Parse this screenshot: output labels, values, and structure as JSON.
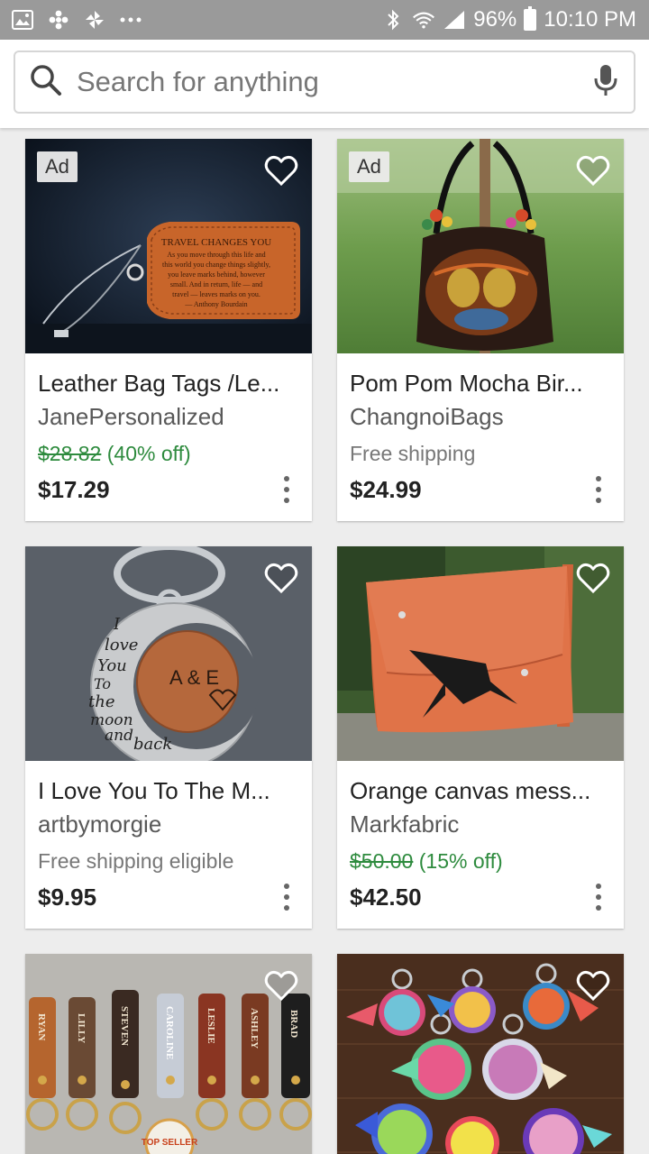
{
  "status_bar": {
    "battery": "96%",
    "time": "10:10 PM",
    "icons_left": [
      "image-icon",
      "fan-icon",
      "pinwheel-icon",
      "more-dots-icon"
    ],
    "icons_right": [
      "bluetooth-icon",
      "wifi-icon",
      "signal-icon",
      "battery-icon"
    ]
  },
  "search": {
    "placeholder": "Search for anything",
    "value": ""
  },
  "listings": [
    {
      "ad": "Ad",
      "title": "Leather Bag Tags /Le...",
      "shop": "JanePersonalized",
      "original_price": "$28.82",
      "discount": "(40% off)",
      "shipping": "",
      "price": "$17.29",
      "image": "leather-tag-photo"
    },
    {
      "ad": "Ad",
      "title": "Pom Pom Mocha Bir...",
      "shop": "ChangnoiBags",
      "original_price": "",
      "discount": "",
      "shipping": "Free shipping",
      "price": "$24.99",
      "image": "embroidered-bag-photo"
    },
    {
      "ad": "",
      "title": "I Love You To The M...",
      "shop": "artbymorgie",
      "original_price": "",
      "discount": "",
      "shipping": "Free shipping eligible",
      "price": "$9.95",
      "image": "keychain-photo"
    },
    {
      "ad": "",
      "title": "Orange canvas mess...",
      "shop": "Markfabric",
      "original_price": "$50.00",
      "discount": "(15% off)",
      "shipping": "",
      "price": "$42.50",
      "image": "orange-bag-photo"
    },
    {
      "ad": "",
      "title": "",
      "shop": "",
      "original_price": "",
      "discount": "",
      "shipping": "",
      "price": "",
      "image": "name-keyrings-photo",
      "badge": "TOP SELLER",
      "names": [
        "RYAN",
        "LILLY",
        "STEVEN",
        "CAROLINE",
        "LESLIE",
        "ASHLEY",
        "BRAD"
      ]
    },
    {
      "ad": "",
      "title": "",
      "shop": "",
      "original_price": "",
      "discount": "",
      "shipping": "",
      "price": "",
      "image": "monogram-keychains-photo"
    }
  ],
  "colors": {
    "sale_green": "#2e8b3e",
    "status_bar": "#9a9a9a"
  }
}
